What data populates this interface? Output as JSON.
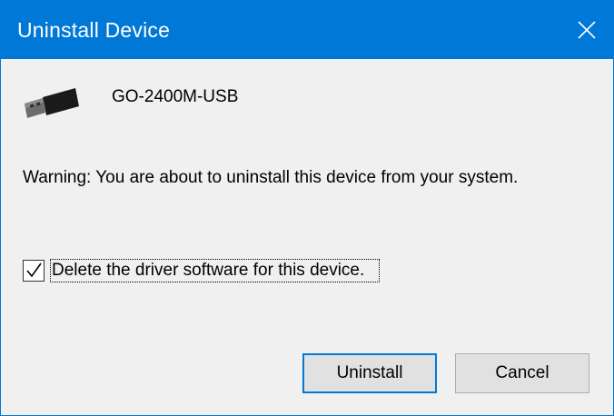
{
  "window": {
    "title": "Uninstall Device",
    "close_icon": "close-x-icon"
  },
  "device": {
    "icon": "usb-connector-icon",
    "name": "GO-2400M-USB"
  },
  "warning_text": "Warning: You are about to uninstall this device from your system.",
  "delete_driver": {
    "checked": true,
    "label": "Delete the driver software for this device."
  },
  "buttons": {
    "uninstall_label": "Uninstall",
    "cancel_label": "Cancel"
  },
  "colors": {
    "accent": "#0078d7",
    "dialog_background": "#f0f0f0",
    "button_background": "#e1e1e1"
  }
}
